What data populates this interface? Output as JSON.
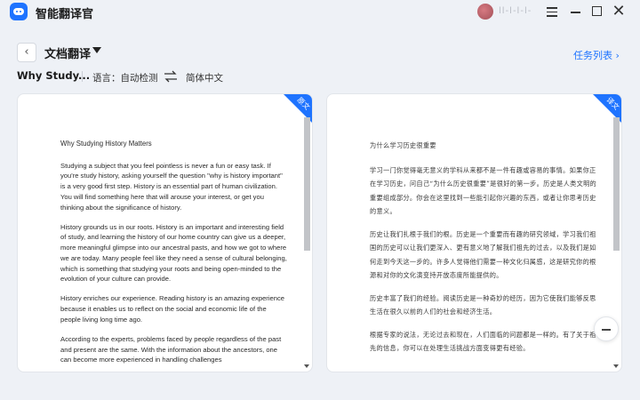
{
  "app": {
    "title": "智能翻译官",
    "username": "ll-l-l-l-"
  },
  "toolbar": {
    "page_title": "文档翻译",
    "task_list": "任务列表 ›",
    "doc_name": "Why Study...",
    "language_label": "语言：自动检测",
    "target_language": "简体中文"
  },
  "source": {
    "badge": "原文",
    "title": "Why Studying History Matters",
    "paragraphs": [
      "Studying a subject that you feel pointless is never a fun or easy task. If you're study history, asking yourself the question \"why is history important\" is a very good first step. History is an essential part of human civilization. You will find something here that will arouse your interest, or get you thinking about the significance of history.",
      "History grounds us in our roots. History is an important and interesting field of study, and learning the history of our home country can give us a deeper, more meaningful glimpse into our ancestral pasts, and how we got to where we are today. Many people feel like they need a sense of cultural belonging, which is something that studying your roots and being open-minded to the evolution of your culture can provide.",
      "History enriches our experience. Reading history is an amazing experience because it enables us to reflect on the social and economic life of the people living long time ago.",
      "According to the experts, problems faced by people regardless of the past and present are the same. With the information about the ancestors, one can become more experienced in handling challenges"
    ]
  },
  "translation": {
    "badge": "译文",
    "title": "为什么学习历史很重要",
    "paragraphs": [
      "学习一门你觉得毫无意义的学科从来都不是一件有趣或容易的事情。如果你正在学习历史，问自己“为什么历史很重要”是很好的第一步。历史是人类文明的重要组成部分。你会在这里找到一些能引起你兴趣的东西，或者让你思考历史的意义。",
      "历史让我们扎根于我们的根。历史是一个重要而有趣的研究领域，学习我们祖国的历史可以让我们更深入、更有意义地了解我们祖先的过去，以及我们是如何走到今天这一步的。许多人觉得他们需要一种文化归属感，这是研究你的根源和对你的文化演变持开放态度所能提供的。",
      "历史丰富了我们的经验。阅读历史是一种奇妙的经历，因为它使我们能够反思生活在很久以前的人们的社会和经济生活。",
      "根据专家的说法，无论过去和现在，人们面临的问题都是一样的。有了关于祖先的信息，你可以在处理生活挑战方面变得更有经验。"
    ]
  },
  "colors": {
    "accent": "#1e73ff",
    "badge": "#1e73ff",
    "background": "#eef1f6"
  },
  "icons": [
    "app-logo-icon",
    "menu-icon",
    "minimize-icon",
    "maximize-icon",
    "close-icon",
    "back-arrow-icon",
    "dropdown-caret-icon",
    "swap-arrows-icon",
    "collapse-icon"
  ]
}
